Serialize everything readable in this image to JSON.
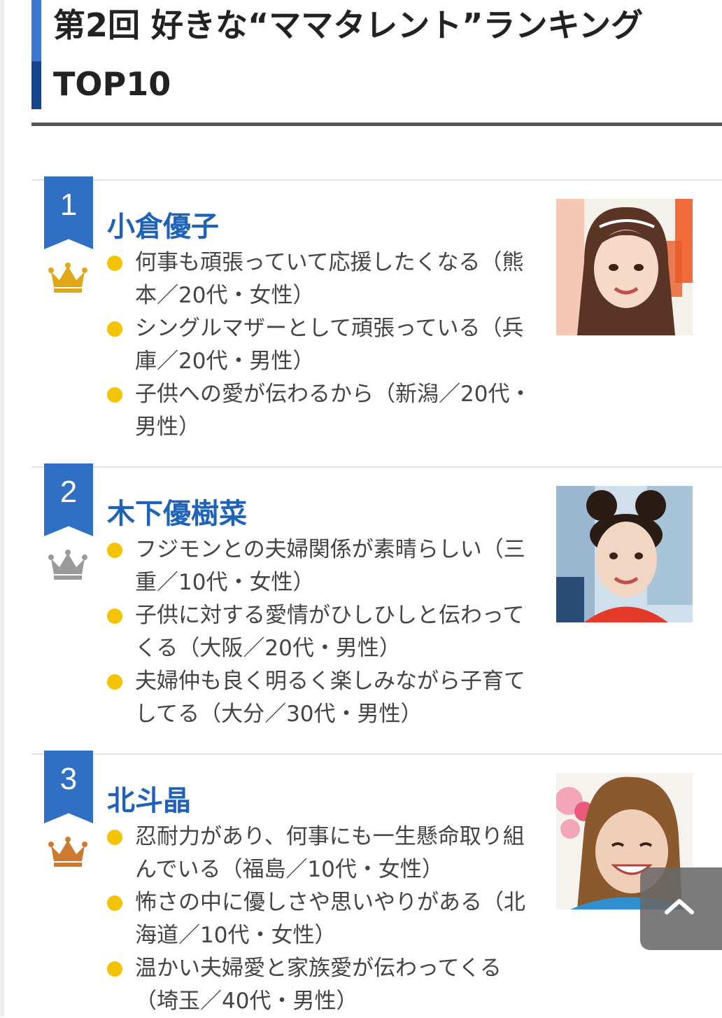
{
  "header": {
    "title_line1": "第2回 好きな“ママタレント”ランキング",
    "title_line2": "TOP10"
  },
  "colors": {
    "accent_blue": "#2f6fc4",
    "name_blue": "#1f63b8",
    "bullet_yellow": "#f5c400",
    "crown_gold": "#e0a817",
    "crown_silver": "#9a9a9a",
    "crown_bronze": "#cc7a32"
  },
  "rankings": [
    {
      "rank": "1",
      "medal": "gold-crown-icon",
      "name": "小倉優子",
      "photo_alt": "portrait",
      "comments": [
        "何事も頑張っていて応援したくなる（熊本／20代・女性）",
        "シングルマザーとして頑張っている（兵庫／20代・男性）",
        "子供への愛が伝わるから（新潟／20代・男性）"
      ]
    },
    {
      "rank": "2",
      "medal": "silver-crown-icon",
      "name": "木下優樹菜",
      "photo_alt": "portrait",
      "comments": [
        "フジモンとの夫婦関係が素晴らしい（三重／10代・女性）",
        "子供に対する愛情がひしひしと伝わってくる（大阪／20代・男性）",
        "夫婦仲も良く明るく楽しみながら子育てしてる（大分／30代・男性）"
      ]
    },
    {
      "rank": "3",
      "medal": "bronze-crown-icon",
      "name": "北斗晶",
      "photo_alt": "portrait",
      "comments": [
        "忍耐力があり、何事にも一生懸命取り組んでいる（福島／10代・女性）",
        "怖さの中に優しさや思いやりがある（北海道／10代・女性）",
        "温かい夫婦愛と家族愛が伝わってくる（埼玉／40代・男性）"
      ]
    }
  ],
  "back_to_top": {
    "icon": "chevron-up-icon"
  }
}
